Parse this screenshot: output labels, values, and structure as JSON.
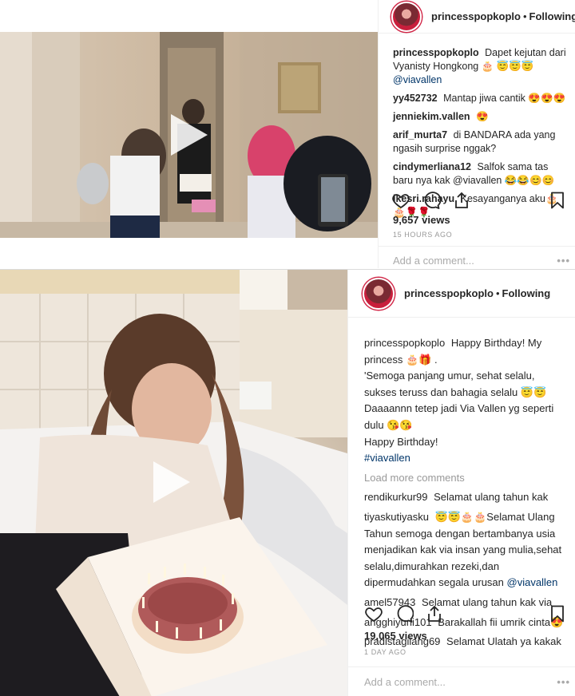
{
  "post1": {
    "header": {
      "username": "princesspopkoplo",
      "separator": "•",
      "follow_status": "Following"
    },
    "caption": {
      "username": "princesspopkoplo",
      "text": "Dapet kejutan dari Vyanisty Hongkong 🎂 😇😇😇",
      "mention": "@viavallen"
    },
    "comments": [
      {
        "username": "yy452732",
        "text": "Mantap jiwa cantik 😍😍😍"
      },
      {
        "username": "jenniekim.vallen",
        "text": "😍"
      },
      {
        "username": "arif_murta7",
        "text": "di BANDARA ada yang ngasih surprise nggak?"
      },
      {
        "username": "cindymerliana12",
        "text": "Salfok sama tas baru nya kak @viavallen 😂😂😊😊"
      },
      {
        "username": "ikesri.rahayu",
        "text": "Kesayanganya aku🎂🎂🌹🌹"
      }
    ],
    "views": "9,657 views",
    "time": "15 HOURS AGO",
    "add_comment_placeholder": "Add a comment...",
    "more_options": "•••"
  },
  "post2": {
    "header": {
      "username": "princesspopkoplo",
      "separator": "•",
      "follow_status": "Following"
    },
    "caption": {
      "username": "princesspopkoplo",
      "line1": "Happy Birthday! My princess 🎂🎁 .",
      "line2": "'Semoga panjang umur, sehat selalu, sukses teruss dan bahagia selalu 😇😇",
      "line3": "Daaaannn tetep jadi Via Vallen yg seperti dulu 😘😘",
      "line4": "Happy Birthday!",
      "hashtag": "#viavallen"
    },
    "load_more": "Load more comments",
    "comments": [
      {
        "username": "rendikurkur99",
        "text": "Selamat ulang tahun kak"
      },
      {
        "username": "tiyaskutiyasku",
        "text": "😇😇🎂🎂Selamat Ulang Tahun semoga dengan bertambanya usia menjadikan kak via insan yang mulia,sehat selalu,dimurahkan rezeki,dan dipermudahkan segala urusan",
        "mention": "@viavallen"
      },
      {
        "username": "amel57943",
        "text": "Selamat ulang tahun kak via"
      },
      {
        "username": "angghiyuni101",
        "text": "Barakallah fii umrik cinta😍"
      },
      {
        "username": "pradistagilang69",
        "text": "Selamat Ulatah ya kakak"
      }
    ],
    "views": "19,065 views",
    "time": "1 DAY AGO",
    "add_comment_placeholder": "Add a comment...",
    "more_options": "•••"
  },
  "colors": {
    "link": "#003569",
    "muted": "#999999",
    "text": "#262626",
    "border": "#efefef"
  },
  "icons": [
    "heart-icon",
    "comment-icon",
    "share-icon",
    "bookmark-icon",
    "play-icon",
    "more-options-icon"
  ]
}
